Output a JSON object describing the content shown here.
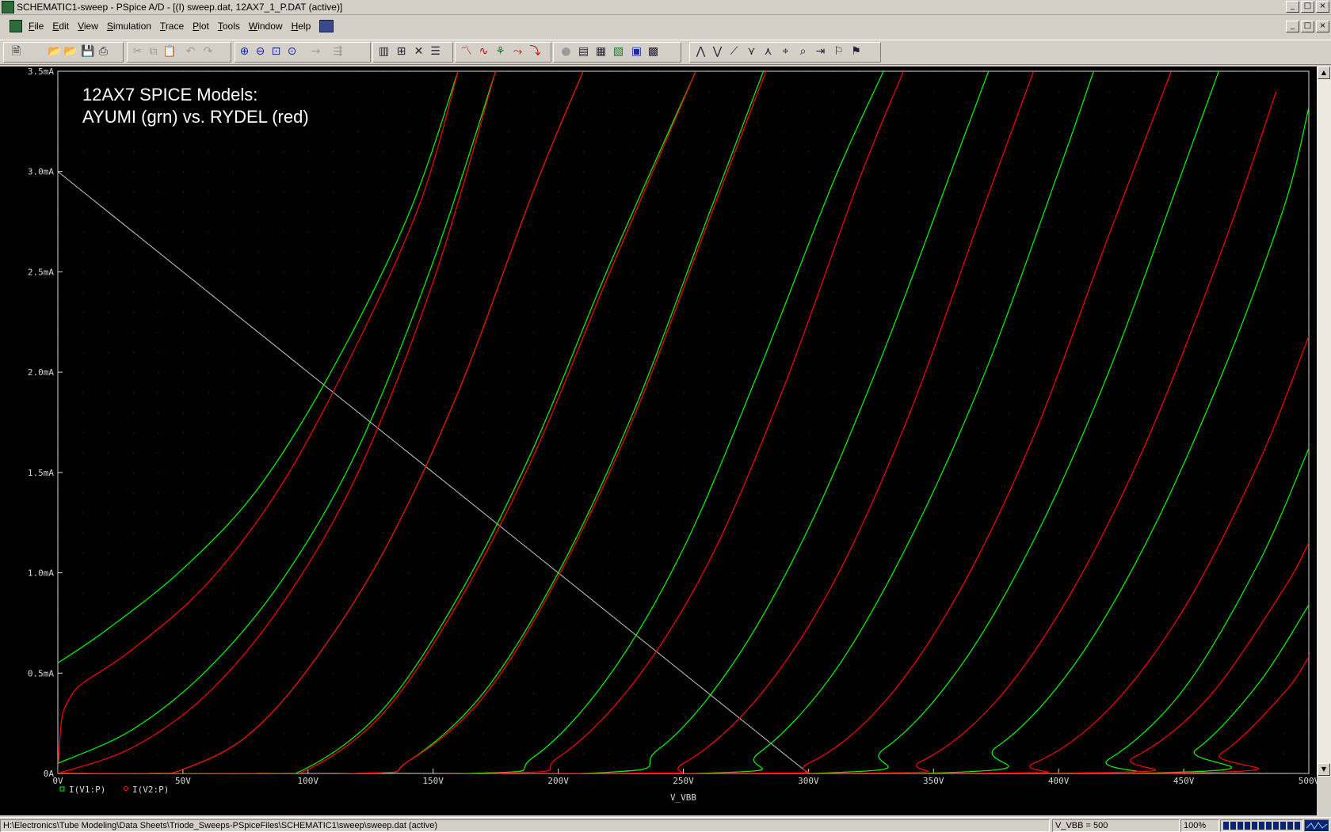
{
  "window": {
    "title": "SCHEMATIC1-sweep - PSpice A/D  - [(I) sweep.dat, 12AX7_1_P.DAT (active)]",
    "min": "_",
    "max": "□",
    "close": "×"
  },
  "menubar": {
    "items": [
      {
        "u": "F",
        "rest": "ile"
      },
      {
        "u": "E",
        "rest": "dit"
      },
      {
        "u": "V",
        "rest": "iew"
      },
      {
        "u": "S",
        "rest": "imulation"
      },
      {
        "u": "T",
        "rest": "race"
      },
      {
        "u": "P",
        "rest": "lot"
      },
      {
        "u": "T",
        "rest": "ools"
      },
      {
        "u": "W",
        "rest": "indow"
      },
      {
        "u": "H",
        "rest": "elp"
      }
    ]
  },
  "toolbar": {
    "buttons": [
      {
        "name": "new-icon",
        "glyph": "🗎"
      },
      {
        "name": "open-icon",
        "glyph": "📂"
      },
      {
        "name": "open-sim-icon",
        "glyph": "📂"
      },
      {
        "name": "save-icon",
        "glyph": "💾"
      },
      {
        "name": "print-icon",
        "glyph": "⎙"
      },
      {
        "name": "cut-icon",
        "glyph": "✂",
        "disabled": true
      },
      {
        "name": "copy-icon",
        "glyph": "⧉",
        "disabled": true
      },
      {
        "name": "paste-icon",
        "glyph": "📋",
        "disabled": true
      },
      {
        "name": "undo-icon",
        "glyph": "↶",
        "disabled": true
      },
      {
        "name": "redo-icon",
        "glyph": "↷",
        "disabled": true
      },
      {
        "name": "zoom-in-icon",
        "glyph": "⊕",
        "color": "blue"
      },
      {
        "name": "zoom-out-icon",
        "glyph": "⊖",
        "color": "blue"
      },
      {
        "name": "zoom-area-icon",
        "glyph": "⊡",
        "color": "blue"
      },
      {
        "name": "zoom-fit-icon",
        "glyph": "⊙",
        "color": "blue"
      },
      {
        "name": "log-x-icon",
        "glyph": "→",
        "disabled": true
      },
      {
        "name": "fourier-icon",
        "glyph": "⇶",
        "disabled": true
      },
      {
        "name": "performance-icon",
        "glyph": "▥"
      },
      {
        "name": "axis-settings-icon",
        "glyph": "⊞"
      },
      {
        "name": "toggle-cursor-icon",
        "glyph": "✕"
      },
      {
        "name": "grid-icon",
        "glyph": "☰"
      },
      {
        "name": "add-trace-icon",
        "glyph": "〽",
        "color": "red"
      },
      {
        "name": "eval-goal-icon",
        "glyph": "∿",
        "color": "red"
      },
      {
        "name": "add-plot-icon",
        "glyph": "⚘",
        "color": "green"
      },
      {
        "name": "delete-plot-icon",
        "glyph": "⤳",
        "color": "red"
      },
      {
        "name": "mark-data-icon",
        "glyph": "⤵",
        "color": "red"
      },
      {
        "name": "run-icon",
        "glyph": "●",
        "disabled": true
      },
      {
        "name": "view-sim-icon",
        "glyph": "▤"
      },
      {
        "name": "view-output-icon",
        "glyph": "▦"
      },
      {
        "name": "view-results-icon",
        "glyph": "▧",
        "color": "green"
      },
      {
        "name": "probe-window-icon",
        "glyph": "▣",
        "color": "blue"
      },
      {
        "name": "markers-icon",
        "glyph": "▩"
      },
      {
        "name": "cursor-peak-icon",
        "glyph": "⋀"
      },
      {
        "name": "cursor-trough-icon",
        "glyph": "⋁"
      },
      {
        "name": "cursor-slope-icon",
        "glyph": "⟋"
      },
      {
        "name": "cursor-min-icon",
        "glyph": "⋎"
      },
      {
        "name": "cursor-max-icon",
        "glyph": "⋏"
      },
      {
        "name": "cursor-point-icon",
        "glyph": "⌖"
      },
      {
        "name": "cursor-search-icon",
        "glyph": "⌕"
      },
      {
        "name": "cursor-next-icon",
        "glyph": "⇥"
      },
      {
        "name": "cursor-label-icon",
        "glyph": "⚐"
      },
      {
        "name": "cursor-mark-icon",
        "glyph": "⚑"
      }
    ]
  },
  "plot": {
    "annotation_line1": "12AX7 SPICE Models:",
    "annotation_line2": "AYUMI  (grn) vs. RYDEL (red)"
  },
  "chart_data": {
    "type": "line",
    "title": "",
    "xlabel": "V_VBB",
    "ylabel": "",
    "xlim": [
      0,
      500
    ],
    "ylim": [
      0,
      3.5
    ],
    "x_ticks": [
      "0V",
      "50V",
      "100V",
      "150V",
      "200V",
      "250V",
      "300V",
      "350V",
      "400V",
      "450V",
      "500V"
    ],
    "y_ticks": [
      "0A",
      "0.5mA",
      "1.0mA",
      "1.5mA",
      "2.0mA",
      "2.5mA",
      "3.0mA",
      "3.5mA"
    ],
    "grid": true,
    "legend": [
      {
        "name": "I(V1:P)",
        "color": "#00ff00",
        "marker": "square"
      },
      {
        "name": "I(V2:P)",
        "color": "#ff0000",
        "marker": "diamond"
      }
    ],
    "load_line": {
      "x": [
        0,
        300
      ],
      "y": [
        3.0,
        0
      ],
      "color": "#c8c8c8"
    },
    "series": [
      {
        "legend": "I(V1:P)",
        "color": "#00ff00",
        "points": [
          [
            0,
            0.55
          ],
          [
            20,
            0.72
          ],
          [
            50,
            1.02
          ],
          [
            80,
            1.42
          ],
          [
            110,
            2.02
          ],
          [
            140,
            2.78
          ],
          [
            160,
            3.5
          ]
        ]
      },
      {
        "legend": "I(V2:P)",
        "color": "#ff0000",
        "points": [
          [
            0,
            0.0
          ],
          [
            1,
            0.2
          ],
          [
            2,
            0.3
          ],
          [
            5,
            0.38
          ],
          [
            10,
            0.45
          ],
          [
            30,
            0.62
          ],
          [
            60,
            0.95
          ],
          [
            90,
            1.45
          ],
          [
            120,
            2.15
          ],
          [
            145,
            2.85
          ],
          [
            160,
            3.5
          ]
        ]
      },
      {
        "legend": "I(V1:P)",
        "color": "#00ff00",
        "points": [
          [
            0,
            0.05
          ],
          [
            30,
            0.22
          ],
          [
            60,
            0.52
          ],
          [
            90,
            0.97
          ],
          [
            120,
            1.62
          ],
          [
            150,
            2.55
          ],
          [
            175,
            3.5
          ]
        ]
      },
      {
        "legend": "I(V2:P)",
        "color": "#ff0000",
        "points": [
          [
            0,
            0.0
          ],
          [
            30,
            0.13
          ],
          [
            60,
            0.4
          ],
          [
            90,
            0.85
          ],
          [
            120,
            1.5
          ],
          [
            150,
            2.45
          ],
          [
            175,
            3.5
          ]
        ]
      },
      {
        "legend": "I(V1:P)",
        "color": "#00ff00",
        "points": [
          [
            37,
            0
          ],
          [
            50,
            0.02
          ],
          [
            75,
            0.18
          ],
          [
            100,
            0.52
          ],
          [
            130,
            1.1
          ],
          [
            160,
            1.9
          ],
          [
            190,
            2.9
          ],
          [
            210,
            3.5
          ]
        ]
      },
      {
        "legend": "I(V2:P)",
        "color": "#ff0000",
        "points": [
          [
            37,
            0
          ],
          [
            50,
            0.02
          ],
          [
            75,
            0.18
          ],
          [
            100,
            0.52
          ],
          [
            130,
            1.1
          ],
          [
            160,
            1.9
          ],
          [
            190,
            2.9
          ],
          [
            210,
            3.5
          ]
        ]
      },
      {
        "legend": "I(V1:P)",
        "color": "#00ff00",
        "points": [
          [
            80,
            0
          ],
          [
            100,
            0.03
          ],
          [
            130,
            0.32
          ],
          [
            160,
            0.88
          ],
          [
            190,
            1.62
          ],
          [
            220,
            2.52
          ],
          [
            255,
            3.5
          ]
        ]
      },
      {
        "legend": "I(V2:P)",
        "color": "#ff0000",
        "points": [
          [
            80,
            0
          ],
          [
            100,
            0.02
          ],
          [
            130,
            0.3
          ],
          [
            160,
            0.85
          ],
          [
            190,
            1.58
          ],
          [
            220,
            2.48
          ],
          [
            255,
            3.5
          ]
        ]
      },
      {
        "legend": "I(V1:P)",
        "color": "#00ff00",
        "points": [
          [
            120,
            0
          ],
          [
            140,
            0.06
          ],
          [
            170,
            0.4
          ],
          [
            200,
            1.0
          ],
          [
            230,
            1.8
          ],
          [
            260,
            2.78
          ],
          [
            282,
            3.5
          ]
        ]
      },
      {
        "legend": "I(V2:P)",
        "color": "#ff0000",
        "points": [
          [
            120,
            0
          ],
          [
            140,
            0.06
          ],
          [
            170,
            0.38
          ],
          [
            200,
            0.98
          ],
          [
            230,
            1.77
          ],
          [
            260,
            2.75
          ],
          [
            283,
            3.5
          ]
        ]
      },
      {
        "legend": "I(V1:P)",
        "color": "#00ff00",
        "points": [
          [
            165,
            0
          ],
          [
            190,
            0.08
          ],
          [
            220,
            0.48
          ],
          [
            250,
            1.12
          ],
          [
            280,
            2.0
          ],
          [
            310,
            2.95
          ],
          [
            330,
            3.5
          ]
        ]
      },
      {
        "legend": "I(V2:P)",
        "color": "#ff0000",
        "points": [
          [
            175,
            0
          ],
          [
            200,
            0.08
          ],
          [
            230,
            0.45
          ],
          [
            260,
            1.05
          ],
          [
            290,
            1.92
          ],
          [
            320,
            2.95
          ],
          [
            338,
            3.5
          ]
        ]
      },
      {
        "legend": "I(V1:P)",
        "color": "#00ff00",
        "points": [
          [
            210,
            0
          ],
          [
            240,
            0.12
          ],
          [
            270,
            0.55
          ],
          [
            300,
            1.22
          ],
          [
            330,
            2.1
          ],
          [
            360,
            3.1
          ],
          [
            372,
            3.5
          ]
        ]
      },
      {
        "legend": "I(V2:P)",
        "color": "#ff0000",
        "points": [
          [
            225,
            0
          ],
          [
            250,
            0.05
          ],
          [
            280,
            0.38
          ],
          [
            310,
            0.95
          ],
          [
            340,
            1.78
          ],
          [
            370,
            2.82
          ],
          [
            390,
            3.5
          ]
        ]
      },
      {
        "legend": "I(V1:P)",
        "color": "#00ff00",
        "points": [
          [
            255,
            0
          ],
          [
            280,
            0.1
          ],
          [
            310,
            0.5
          ],
          [
            340,
            1.15
          ],
          [
            370,
            1.98
          ],
          [
            400,
            3.0
          ],
          [
            414,
            3.5
          ]
        ]
      },
      {
        "legend": "I(V2:P)",
        "color": "#ff0000",
        "points": [
          [
            270,
            0
          ],
          [
            300,
            0.05
          ],
          [
            330,
            0.35
          ],
          [
            360,
            0.9
          ],
          [
            390,
            1.68
          ],
          [
            420,
            2.68
          ],
          [
            445,
            3.5
          ]
        ]
      },
      {
        "legend": "I(V1:P)",
        "color": "#00ff00",
        "points": [
          [
            300,
            0
          ],
          [
            330,
            0.12
          ],
          [
            360,
            0.52
          ],
          [
            390,
            1.16
          ],
          [
            420,
            2.0
          ],
          [
            450,
            3.02
          ],
          [
            464,
            3.5
          ]
        ]
      },
      {
        "legend": "I(V2:P)",
        "color": "#ff0000",
        "points": [
          [
            315,
            0
          ],
          [
            345,
            0.06
          ],
          [
            375,
            0.36
          ],
          [
            405,
            0.9
          ],
          [
            435,
            1.65
          ],
          [
            465,
            2.6
          ],
          [
            487,
            3.4
          ]
        ]
      },
      {
        "legend": "I(V1:P)",
        "color": "#00ff00",
        "points": [
          [
            345,
            0
          ],
          [
            375,
            0.13
          ],
          [
            405,
            0.52
          ],
          [
            435,
            1.15
          ],
          [
            465,
            1.98
          ],
          [
            490,
            2.82
          ],
          [
            500,
            3.32
          ]
        ]
      },
      {
        "legend": "I(V2:P)",
        "color": "#ff0000",
        "points": [
          [
            360,
            0
          ],
          [
            390,
            0.05
          ],
          [
            420,
            0.32
          ],
          [
            450,
            0.82
          ],
          [
            480,
            1.55
          ],
          [
            500,
            2.18
          ]
        ]
      },
      {
        "legend": "I(V1:P)",
        "color": "#00ff00",
        "points": [
          [
            395,
            0
          ],
          [
            420,
            0.07
          ],
          [
            450,
            0.42
          ],
          [
            480,
            1.05
          ],
          [
            500,
            1.62
          ]
        ]
      },
      {
        "legend": "I(V2:P)",
        "color": "#ff0000",
        "points": [
          [
            400,
            0
          ],
          [
            430,
            0.08
          ],
          [
            460,
            0.38
          ],
          [
            490,
            0.92
          ],
          [
            500,
            1.15
          ]
        ]
      },
      {
        "legend": "I(V1:P)",
        "color": "#00ff00",
        "points": [
          [
            430,
            0
          ],
          [
            455,
            0.12
          ],
          [
            480,
            0.45
          ],
          [
            500,
            0.84
          ]
        ]
      },
      {
        "legend": "I(V2:P)",
        "color": "#ff0000",
        "points": [
          [
            440,
            0
          ],
          [
            465,
            0.1
          ],
          [
            490,
            0.4
          ],
          [
            500,
            0.58
          ]
        ]
      }
    ]
  },
  "statusbar": {
    "path": "H:\\Electronics\\Tube Modeling\\Data Sheets\\Triode_Sweeps-PSpiceFiles\\SCHEMATIC1\\sweep\\sweep.dat (active)",
    "sweep_value": "V_VBB = 500",
    "zoom": "100%",
    "progress": 1.0
  }
}
